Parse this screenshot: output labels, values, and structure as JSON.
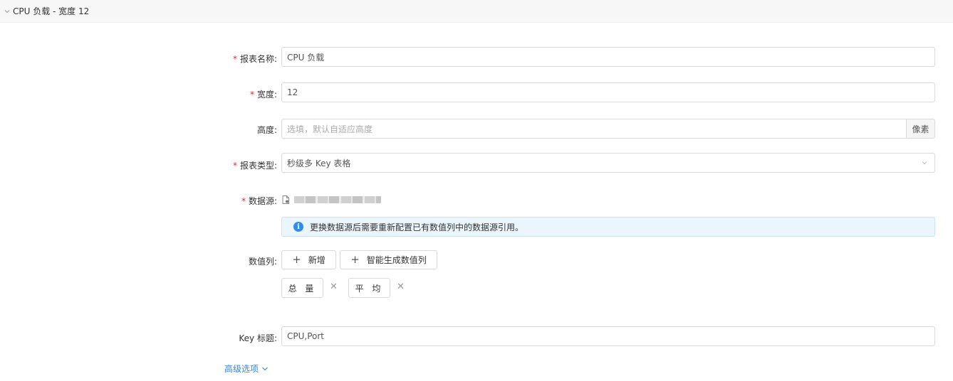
{
  "panel": {
    "title": "CPU 负载 - 宽度 12"
  },
  "form": {
    "report_name": {
      "label": "报表名称:",
      "value": "CPU 负载",
      "required": true
    },
    "width": {
      "label": "宽度:",
      "value": "12",
      "required": true
    },
    "height": {
      "label": "高度:",
      "placeholder": "选填，默认自适应高度",
      "addon": "像素"
    },
    "report_type": {
      "label": "报表类型:",
      "value": "秒级多 Key 表格",
      "required": true
    },
    "datasource": {
      "label": "数据源:",
      "required": true
    },
    "alert": {
      "icon": "info-icon",
      "text": "更换数据源后需要重新配置已有数值列中的数据源引用。"
    },
    "value_columns": {
      "label": "数值列:",
      "add_button": "新增",
      "smart_button": "智能生成数值列",
      "tags": [
        "总 量",
        "平 均"
      ]
    },
    "key_title": {
      "label": "Key 标题:",
      "value": "CPU,Port"
    },
    "advanced": "高级选项"
  },
  "colors": {
    "accent": "#2d8cf0",
    "required": "#f5222d",
    "alert_bg": "#eaf5fd"
  }
}
